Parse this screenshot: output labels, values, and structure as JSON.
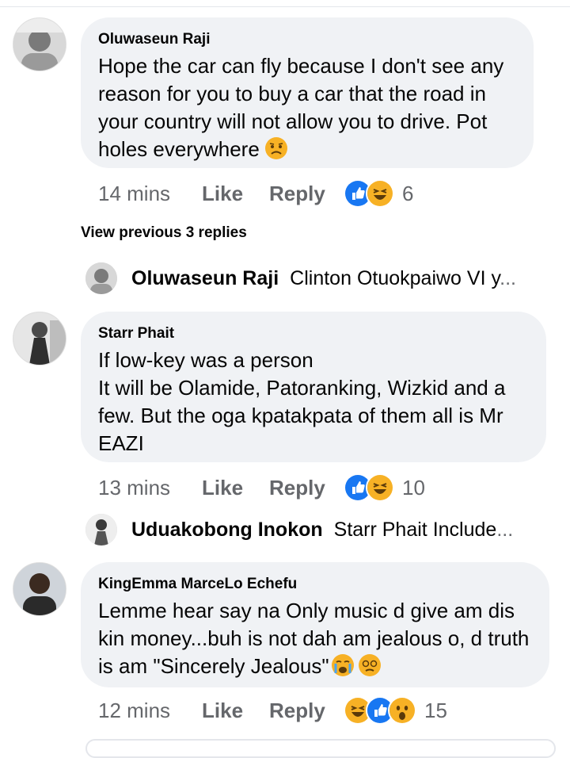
{
  "comments": [
    {
      "author": "Oluwaseun Raji",
      "text": "Hope the car can fly because I don't see any reason for you to buy a car that the road in your country will not allow you to drive. Pot holes everywhere",
      "time": "14 mins",
      "like_label": "Like",
      "reply_label": "Reply",
      "reactions": [
        "like",
        "haha"
      ],
      "reaction_count": "6",
      "trailing_emojis": [
        "worried-face"
      ]
    },
    {
      "author": "Starr Phait",
      "text": "If low-key was a person\nIt will be Olamide, Patoranking, Wizkid and a few. But the oga kpatakpata of them all is Mr EAZI",
      "time": "13 mins",
      "like_label": "Like",
      "reply_label": "Reply",
      "reactions": [
        "like",
        "haha"
      ],
      "reaction_count": "10"
    },
    {
      "author": "KingEmma MarceLo Echefu",
      "text": "Lemme hear say na Only music d give am dis kin money...buh is not dah am jealous o, d truth is am \"Sincerely Jealous\"",
      "time": "12 mins",
      "like_label": "Like",
      "reply_label": "Reply",
      "reactions": [
        "haha",
        "like",
        "wow"
      ],
      "reaction_count": "15",
      "trailing_emojis": [
        "crying-face",
        "dizzy-face"
      ]
    }
  ],
  "view_previous": "View previous 3 replies",
  "replies": [
    {
      "author": "Oluwaseun Raji",
      "text": "Clinton Otuokpaiwo  VI y",
      "ellipsis": "..."
    },
    {
      "author": "Uduakobong Inokon",
      "text": "Starr Phait Include",
      "ellipsis": "..."
    }
  ],
  "colors": {
    "bubble": "#f0f2f5",
    "secondary_text": "#65676b",
    "like_blue": "#1877f2",
    "haha_yellow": "#f7b125"
  }
}
